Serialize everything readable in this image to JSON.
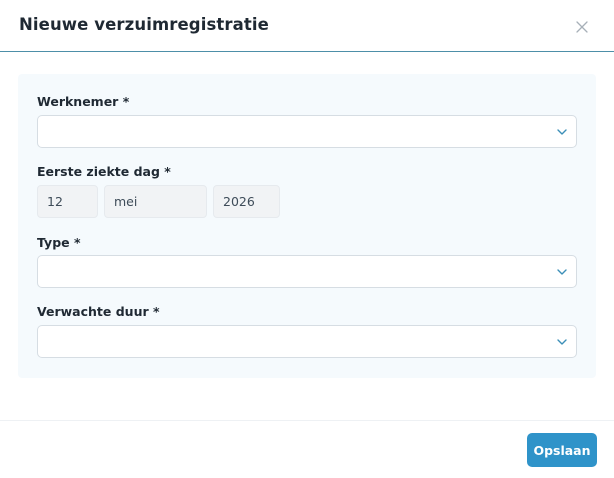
{
  "modal": {
    "title": "Nieuwe verzuimregistratie",
    "close_icon": "close-icon"
  },
  "form": {
    "werknemer": {
      "label": "Werknemer *",
      "value": "",
      "icon": "chevron-down-icon"
    },
    "eerste_ziekte_dag": {
      "label": "Eerste ziekte dag *",
      "day": "12",
      "month": "mei",
      "year": "2026"
    },
    "type": {
      "label": "Type *",
      "value": "",
      "icon": "chevron-down-icon"
    },
    "verwachte_duur": {
      "label": "Verwachte duur *",
      "value": "",
      "icon": "chevron-down-icon"
    }
  },
  "footer": {
    "save_label": "Opslaan"
  },
  "colors": {
    "accent": "#2f93c9",
    "header_border": "#4d8fa8",
    "panel_bg": "#f5fafd"
  }
}
